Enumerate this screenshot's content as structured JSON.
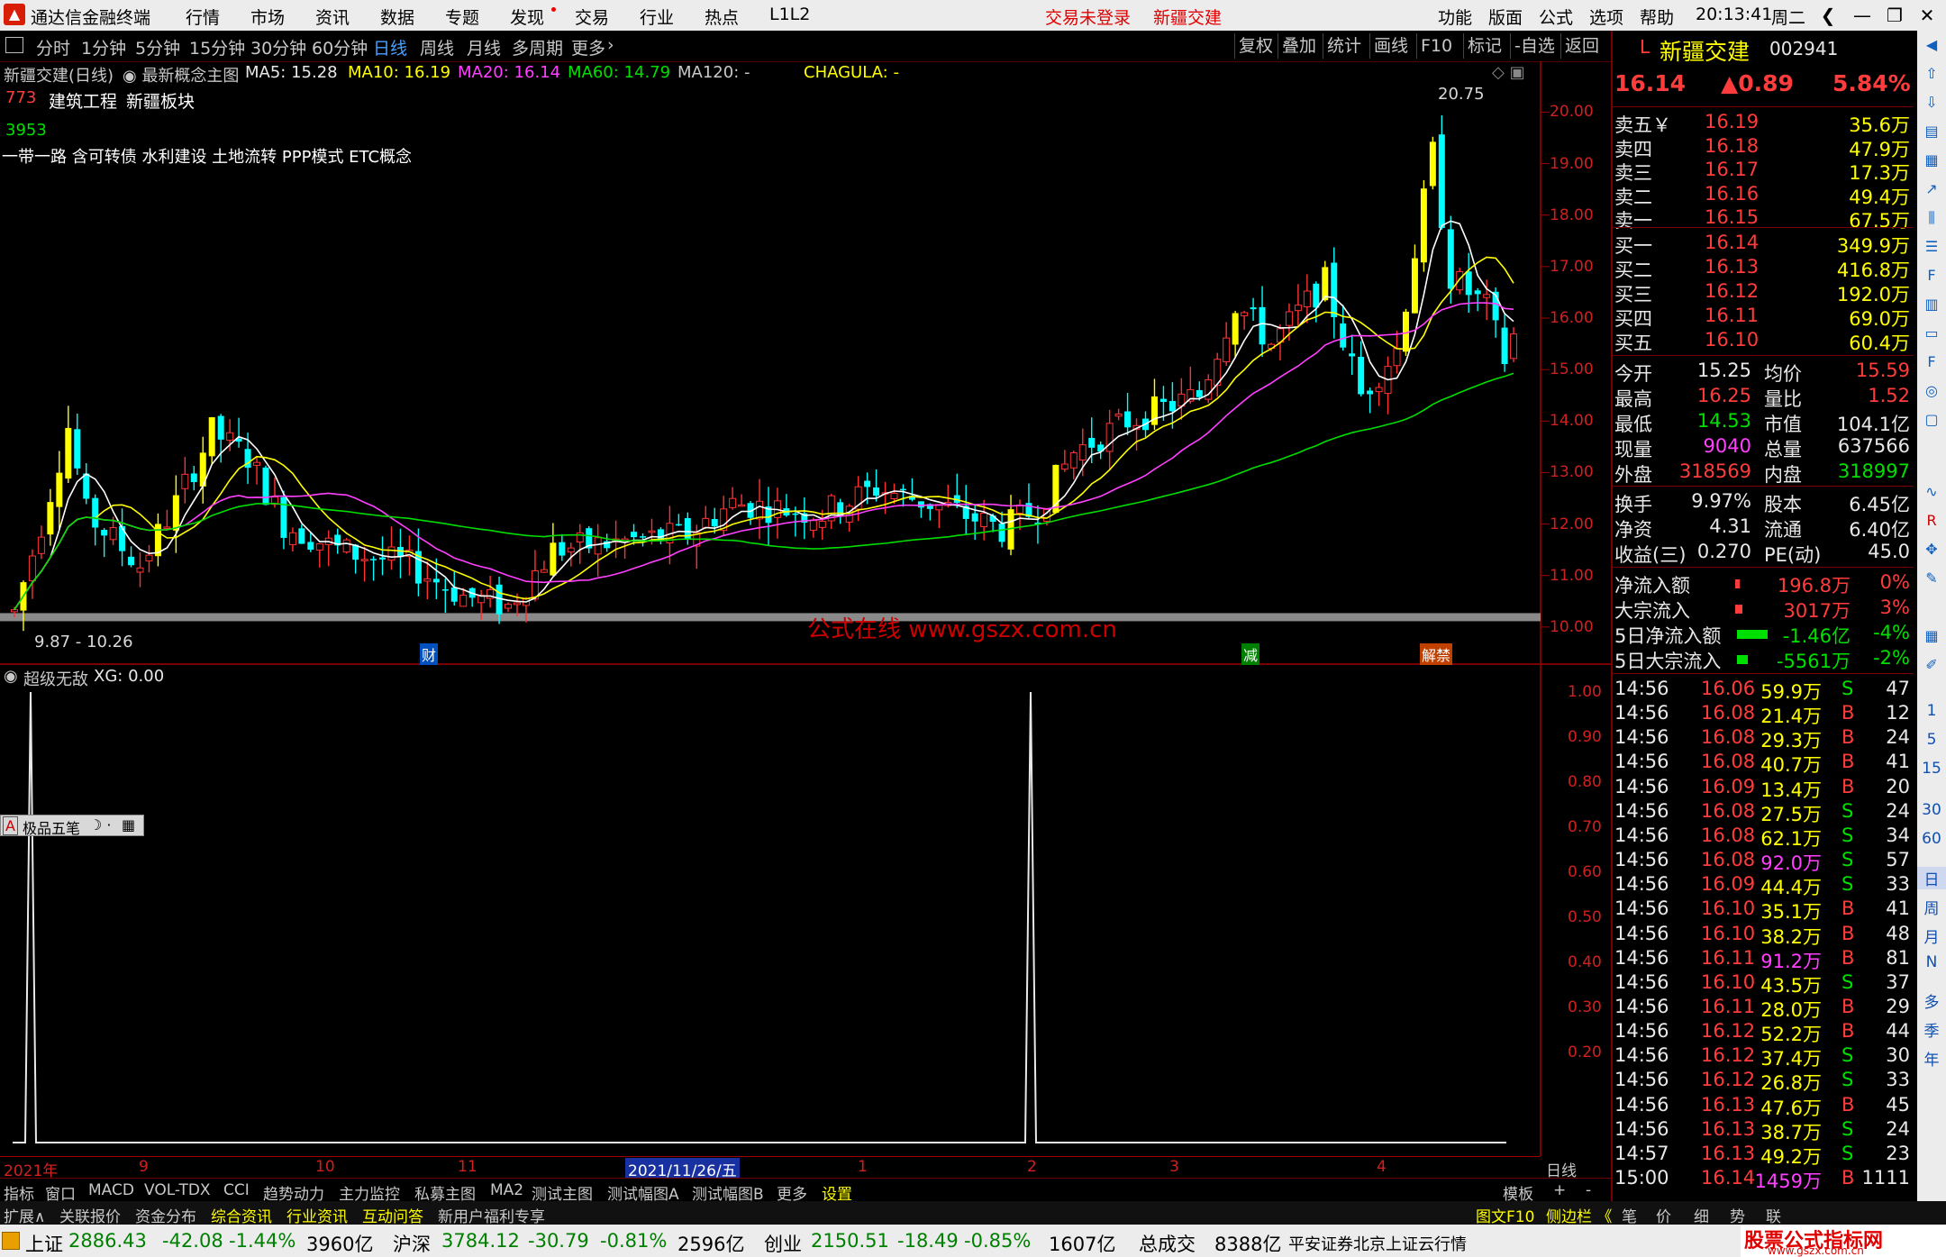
{
  "menubar": {
    "app_title": "通达信金融终端",
    "menus": [
      "行情",
      "市场",
      "资讯",
      "数据",
      "专题",
      "发现",
      "交易",
      "行业",
      "热点",
      "L1L2"
    ],
    "login_status": "交易未登录",
    "stock_name": "新疆交建",
    "right_menus": [
      "功能",
      "版面",
      "公式",
      "选项",
      "帮助"
    ],
    "time": "20:13:41",
    "weekday": "周二"
  },
  "toolbar": {
    "periods": [
      "分时",
      "1分钟",
      "5分钟",
      "15分钟",
      "30分钟",
      "60分钟",
      "日线",
      "周线",
      "月线",
      "多周期",
      "更多"
    ],
    "active_period": "日线",
    "right_buttons": [
      "复权",
      "叠加",
      "统计",
      "画线",
      "F10",
      "标记",
      "-自选",
      "返回"
    ]
  },
  "main_chart": {
    "title": "新疆交建(日线)",
    "template": "最新概念主图",
    "ma5": "MA5: 15.28",
    "ma10": "MA10: 16.19",
    "ma20": "MA20: 16.14",
    "ma60": "MA60: 14.79",
    "ma120": "MA120: -",
    "chagula": "CHAGULA: -",
    "rank": "773",
    "sector1": "建筑工程",
    "sector2": "新疆板块",
    "code_num": "3953",
    "concepts": "一带一路 含可转债 水利建设 土地流转 PPP模式 ETC概念",
    "high_label": "20.75",
    "low_label": "9.87 - 10.26",
    "watermark": "公式在线  www.gszx.com.cn",
    "marker_cai": "财",
    "marker_jian": "减",
    "marker_jiejin": "解禁",
    "y_ticks": [
      "20.00",
      "19.00",
      "18.00",
      "17.00",
      "16.00",
      "15.00",
      "14.00",
      "13.00",
      "12.00",
      "11.00",
      "10.00"
    ],
    "colors": {
      "up": "#ff3232",
      "down": "#00ffff",
      "limit": "#ffff00",
      "ma5": "#ffffff",
      "ma10": "#ffff00",
      "ma20": "#ff40ff",
      "ma60": "#00dd00"
    }
  },
  "indicator": {
    "title": "超级无敌",
    "value": "XG: 0.00",
    "y_ticks": [
      "1.00",
      "0.90",
      "0.80",
      "0.70",
      "0.60",
      "0.50",
      "0.40",
      "0.30",
      "0.20"
    ],
    "ime_label": "极品五笔"
  },
  "chart_data": {
    "type": "candlestick",
    "signal_spike_indices": [
      3,
      126
    ],
    "ylim": [
      9.7,
      20.9
    ]
  },
  "date_axis": {
    "labels": [
      "2021年",
      "9",
      "10",
      "11",
      "2021/11/26/五",
      "1",
      "2",
      "3",
      "4"
    ],
    "right_label": "日线"
  },
  "tabs_row1": {
    "items": [
      "指标",
      "窗口",
      "MACD",
      "VOL-TDX",
      "CCI",
      "趋势动力",
      "主力监控",
      "私募主图",
      "MA2",
      "测试主图",
      "测试幅图A",
      "测试幅图B",
      "更多",
      "设置"
    ],
    "right_items": [
      "模板",
      "+",
      "-"
    ]
  },
  "tabs_row2": {
    "items": [
      "扩展∧",
      "关联报价",
      "资金分布",
      "综合资讯",
      "行业资讯",
      "互动问答",
      "新用户福利专享"
    ],
    "right_items": [
      "图文F10",
      "侧边栏 《",
      "笔",
      "价",
      "细",
      "势",
      "联"
    ]
  },
  "statusbar": {
    "sh_label": "上证",
    "sh_val": "2886.43",
    "sh_chg": "-42.08",
    "sh_pct": "-1.44%",
    "sh_amt": "3960亿",
    "hs_label": "沪深",
    "hs_val": "3784.12",
    "hs_chg": "-30.79",
    "hs_pct": "-0.81%",
    "hs_amt": "2596亿",
    "cy_label": "创业",
    "cy_val": "2150.51",
    "cy_chg": "-18.49",
    "cy_pct": "-0.85%",
    "cy_amt": "1607亿",
    "total_label": "总成交",
    "total_val": "8388亿",
    "broker": "平安证券北京上证云行情",
    "brand": "股票公式指标网",
    "brand_url": "www.gszx.com.cn"
  },
  "quote": {
    "prefix": "L",
    "name": "新疆交建",
    "code": "002941",
    "price": "16.14",
    "change": "▲0.89",
    "pct": "5.84%",
    "asks": [
      {
        "label": "卖五￥",
        "price": "16.19",
        "vol": "35.6万"
      },
      {
        "label": "卖四",
        "price": "16.18",
        "vol": "47.9万"
      },
      {
        "label": "卖三",
        "price": "16.17",
        "vol": "17.3万"
      },
      {
        "label": "卖二",
        "price": "16.16",
        "vol": "49.4万"
      },
      {
        "label": "卖一",
        "price": "16.15",
        "vol": "67.5万"
      }
    ],
    "bids": [
      {
        "label": "买一",
        "price": "16.14",
        "vol": "349.9万"
      },
      {
        "label": "买二",
        "price": "16.13",
        "vol": "416.8万"
      },
      {
        "label": "买三",
        "price": "16.12",
        "vol": "192.0万"
      },
      {
        "label": "买四",
        "price": "16.11",
        "vol": "69.0万"
      },
      {
        "label": "买五",
        "price": "16.10",
        "vol": "60.4万"
      }
    ],
    "stats": [
      {
        "l1": "今开",
        "v1": "15.25",
        "c1": "wht",
        "l2": "均价",
        "v2": "15.59",
        "c2": "red"
      },
      {
        "l1": "最高",
        "v1": "16.25",
        "c1": "red",
        "l2": "量比",
        "v2": "1.52",
        "c2": "red"
      },
      {
        "l1": "最低",
        "v1": "14.53",
        "c1": "grn",
        "l2": "市值",
        "v2": "104.1亿",
        "c2": "wht"
      },
      {
        "l1": "现量",
        "v1": "9040",
        "c1": "mag",
        "l2": "总量",
        "v2": "637566",
        "c2": "wht"
      },
      {
        "l1": "外盘",
        "v1": "318569",
        "c1": "red",
        "l2": "内盘",
        "v2": "318997",
        "c2": "grn"
      }
    ],
    "stats2": [
      {
        "l1": "换手",
        "v1": "9.97%",
        "l2": "股本",
        "v2": "6.45亿"
      },
      {
        "l1": "净资",
        "v1": "4.31",
        "l2": "流通",
        "v2": "6.40亿"
      },
      {
        "l1": "收益(三)",
        "v1": "0.270",
        "l2": "PE(动)",
        "v2": "45.0"
      }
    ],
    "flows": [
      {
        "label": "净流入额",
        "val": "196.8万",
        "pct": "0%",
        "color": "red"
      },
      {
        "label": "大宗流入",
        "val": "3017万",
        "pct": "3%",
        "color": "red"
      },
      {
        "label": "5日净流入额",
        "val": "-1.46亿",
        "pct": "-4%",
        "color": "grn"
      },
      {
        "label": "5日大宗流入",
        "val": "-5561万",
        "pct": "-2%",
        "color": "grn"
      }
    ],
    "ticks": [
      {
        "t": "14:56",
        "p": "16.06",
        "v": "59.9万",
        "d": "S",
        "n": "47"
      },
      {
        "t": "14:56",
        "p": "16.08",
        "v": "21.4万",
        "d": "B",
        "n": "12"
      },
      {
        "t": "14:56",
        "p": "16.08",
        "v": "29.3万",
        "d": "B",
        "n": "24"
      },
      {
        "t": "14:56",
        "p": "16.08",
        "v": "40.7万",
        "d": "B",
        "n": "41"
      },
      {
        "t": "14:56",
        "p": "16.09",
        "v": "13.4万",
        "d": "B",
        "n": "20"
      },
      {
        "t": "14:56",
        "p": "16.08",
        "v": "27.5万",
        "d": "S",
        "n": "24"
      },
      {
        "t": "14:56",
        "p": "16.08",
        "v": "62.1万",
        "d": "S",
        "n": "34"
      },
      {
        "t": "14:56",
        "p": "16.08",
        "v": "92.0万",
        "d": "S",
        "n": "57"
      },
      {
        "t": "14:56",
        "p": "16.09",
        "v": "44.4万",
        "d": "S",
        "n": "33"
      },
      {
        "t": "14:56",
        "p": "16.10",
        "v": "35.1万",
        "d": "B",
        "n": "41"
      },
      {
        "t": "14:56",
        "p": "16.10",
        "v": "38.2万",
        "d": "B",
        "n": "48"
      },
      {
        "t": "14:56",
        "p": "16.11",
        "v": "91.2万",
        "d": "B",
        "n": "81"
      },
      {
        "t": "14:56",
        "p": "16.10",
        "v": "43.5万",
        "d": "S",
        "n": "37"
      },
      {
        "t": "14:56",
        "p": "16.11",
        "v": "28.0万",
        "d": "B",
        "n": "29"
      },
      {
        "t": "14:56",
        "p": "16.12",
        "v": "52.2万",
        "d": "B",
        "n": "44"
      },
      {
        "t": "14:56",
        "p": "16.12",
        "v": "37.4万",
        "d": "S",
        "n": "30"
      },
      {
        "t": "14:56",
        "p": "16.12",
        "v": "26.8万",
        "d": "S",
        "n": "33"
      },
      {
        "t": "14:56",
        "p": "16.13",
        "v": "47.6万",
        "d": "B",
        "n": "45"
      },
      {
        "t": "14:56",
        "p": "16.13",
        "v": "38.7万",
        "d": "S",
        "n": "24"
      },
      {
        "t": "14:57",
        "p": "16.13",
        "v": "49.2万",
        "d": "S",
        "n": "23"
      },
      {
        "t": "15:00",
        "p": "16.14",
        "v": "1459万",
        "d": "B",
        "n": "1111"
      }
    ]
  },
  "sidebar": {
    "labels": [
      "1",
      "5",
      "15",
      "30",
      "60",
      "日",
      "周",
      "月",
      "N",
      "多",
      "季",
      "年"
    ]
  }
}
